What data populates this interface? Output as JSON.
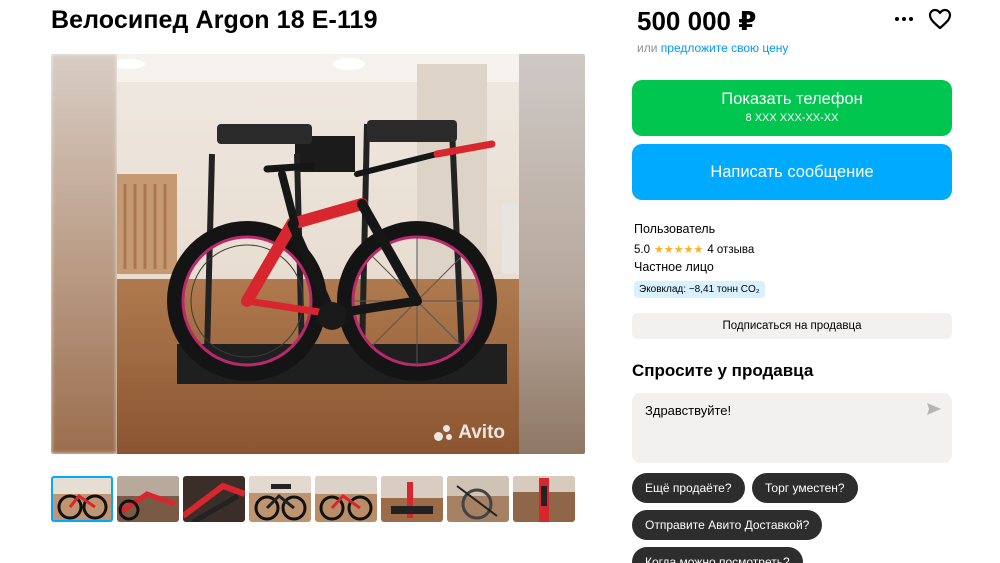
{
  "listing": {
    "title": "Велосипед Argon 18 E-119",
    "price": "500 000 ₽",
    "price_or": "или",
    "price_offer_link": "предложите свою цену"
  },
  "gallery": {
    "watermark": "Avito",
    "thumb_count": 8,
    "active_thumb": 1
  },
  "actions": {
    "show_phone_label": "Показать телефон",
    "phone_mask": "8 XXX XXX-XX-XX",
    "write_message_label": "Написать сообщение",
    "subscribe_label": "Подписаться на продавца"
  },
  "seller": {
    "name": "Пользователь",
    "rating": "5.0",
    "stars": "★★★★★",
    "reviews": "4 отзыва",
    "type": "Частное лицо",
    "eco": "Эковклад: −8,41 тонн CO₂"
  },
  "ask": {
    "title": "Спросите у продавца",
    "message": "Здравствуйте!",
    "suggestions": [
      "Ещё продаёте?",
      "Торг уместен?",
      "Отправите Авито Доставкой?",
      "Когда можно посмотреть?"
    ]
  },
  "icons": {
    "more": "more-dots-icon",
    "favorite": "heart-icon",
    "send": "send-icon"
  },
  "colors": {
    "green": "#00c64f",
    "blue": "#00aaff",
    "link": "#0099f7",
    "chip": "#2d2d2d",
    "star": "#ffb021"
  }
}
